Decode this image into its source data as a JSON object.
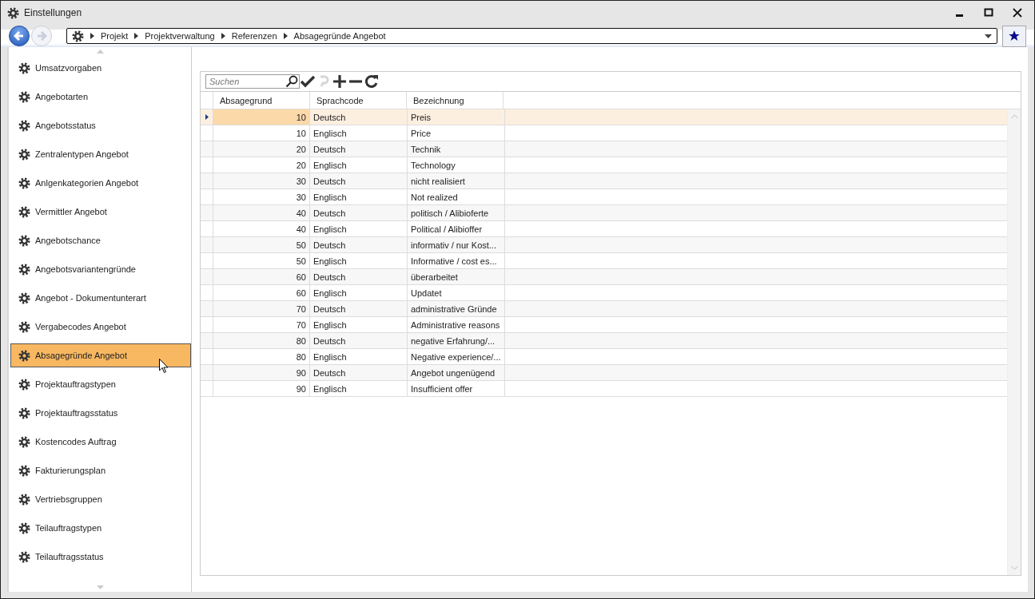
{
  "window": {
    "title": "Einstellungen"
  },
  "nav_buttons": [
    {
      "kind": "back",
      "disabled": false
    },
    {
      "kind": "forward",
      "disabled": true
    }
  ],
  "breadcrumb": [
    "Projekt",
    "Projektverwaltung",
    "Referenzen",
    "Absagegründe Angebot"
  ],
  "sidebar": {
    "items": [
      {
        "label": "Umsatzvorgaben",
        "selected": false
      },
      {
        "label": "Angebotarten",
        "selected": false
      },
      {
        "label": "Angebotsstatus",
        "selected": false
      },
      {
        "label": "Zentralentypen Angebot",
        "selected": false
      },
      {
        "label": "Anlgenkategorien Angebot",
        "selected": false
      },
      {
        "label": "Vermittler Angebot",
        "selected": false
      },
      {
        "label": "Angebotschance",
        "selected": false
      },
      {
        "label": "Angebotsvariantengründe",
        "selected": false
      },
      {
        "label": "Angebot - Dokumentunterart",
        "selected": false
      },
      {
        "label": "Vergabecodes Angebot",
        "selected": false
      },
      {
        "label": "Absagegründe Angebot",
        "selected": true
      },
      {
        "label": "Projektauftragstypen",
        "selected": false
      },
      {
        "label": "Projektauftragsstatus",
        "selected": false
      },
      {
        "label": "Kostencodes Auftrag",
        "selected": false
      },
      {
        "label": "Fakturierungsplan",
        "selected": false
      },
      {
        "label": "Vertriebsgruppen",
        "selected": false
      },
      {
        "label": "Teilauftragstypen",
        "selected": false
      },
      {
        "label": "Teilauftragsstatus",
        "selected": false
      }
    ]
  },
  "toolbar": {
    "search": {
      "placeholder": "Suchen"
    },
    "tools": [
      {
        "kind": "save",
        "disabled": false
      },
      {
        "kind": "undo",
        "disabled": true
      },
      {
        "kind": "add",
        "disabled": false
      },
      {
        "kind": "remove",
        "disabled": false
      },
      {
        "kind": "refresh",
        "disabled": false
      }
    ]
  },
  "table": {
    "columns": [
      "Absagegrund",
      "Sprachcode",
      "Bezeichnung"
    ],
    "rows": [
      {
        "cells": [
          "10",
          "Deutsch",
          "Preis"
        ],
        "selected": true
      },
      {
        "cells": [
          "10",
          "Englisch",
          "Price"
        ],
        "selected": false
      },
      {
        "cells": [
          "20",
          "Deutsch",
          "Technik"
        ],
        "selected": false
      },
      {
        "cells": [
          "20",
          "Englisch",
          "Technology"
        ],
        "selected": false
      },
      {
        "cells": [
          "30",
          "Deutsch",
          "nicht realisiert"
        ],
        "selected": false
      },
      {
        "cells": [
          "30",
          "Englisch",
          "Not realized"
        ],
        "selected": false
      },
      {
        "cells": [
          "40",
          "Deutsch",
          "politisch / Alibioferte"
        ],
        "selected": false
      },
      {
        "cells": [
          "40",
          "Englisch",
          "Political / Alibioffer"
        ],
        "selected": false
      },
      {
        "cells": [
          "50",
          "Deutsch",
          "informativ / nur Kost..."
        ],
        "selected": false
      },
      {
        "cells": [
          "50",
          "Englisch",
          "Informative / cost es..."
        ],
        "selected": false
      },
      {
        "cells": [
          "60",
          "Deutsch",
          "überarbeitet"
        ],
        "selected": false
      },
      {
        "cells": [
          "60",
          "Englisch",
          "Updatet"
        ],
        "selected": false
      },
      {
        "cells": [
          "70",
          "Deutsch",
          "administrative Gründe"
        ],
        "selected": false
      },
      {
        "cells": [
          "70",
          "Englisch",
          "Administrative reasons"
        ],
        "selected": false
      },
      {
        "cells": [
          "80",
          "Deutsch",
          "negative Erfahrung/..."
        ],
        "selected": false
      },
      {
        "cells": [
          "80",
          "Englisch",
          "Negative experience/..."
        ],
        "selected": false
      },
      {
        "cells": [
          "90",
          "Deutsch",
          "Angebot ungenügend"
        ],
        "selected": false
      },
      {
        "cells": [
          "90",
          "Englisch",
          "Insufficient offer"
        ],
        "selected": false
      }
    ]
  }
}
